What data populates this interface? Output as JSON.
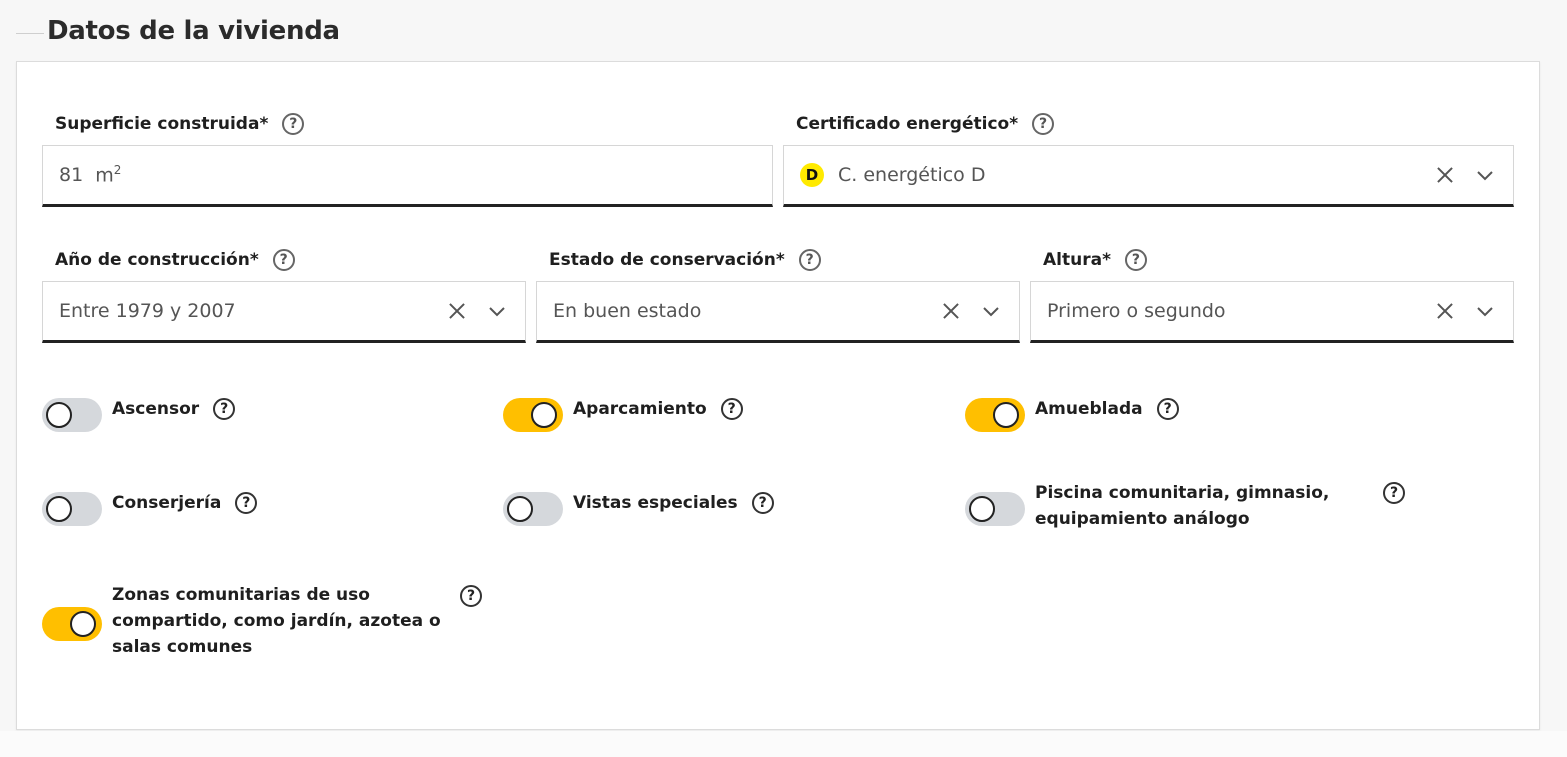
{
  "section": {
    "title": "Datos de la vivienda"
  },
  "fields": {
    "superficie": {
      "label": "Superficie construida*",
      "value": "81",
      "unit": "m",
      "unit_sup": "2"
    },
    "certificado": {
      "label": "Certificado energético*",
      "badge": "D",
      "value": "C. energético D"
    },
    "anio": {
      "label": "Año de construcción*",
      "value": "Entre 1979 y 2007"
    },
    "estado": {
      "label": "Estado de conservación*",
      "value": "En buen estado"
    },
    "altura": {
      "label": "Altura*",
      "value": "Primero o segundo"
    }
  },
  "toggles": {
    "ascensor": {
      "label": "Ascensor",
      "on": false
    },
    "aparcamiento": {
      "label": "Aparcamiento",
      "on": true
    },
    "amueblada": {
      "label": "Amueblada",
      "on": true
    },
    "conserjeria": {
      "label": "Conserjería",
      "on": false
    },
    "vistas": {
      "label": "Vistas especiales",
      "on": false
    },
    "piscina": {
      "label_line1": "Piscina comunitaria, gimnasio,",
      "label_line2": "equipamiento análogo",
      "on": false
    },
    "zonas": {
      "label_line1": "Zonas comunitarias de uso",
      "label_line2": "compartido, como jardín, azotea o",
      "label_line3": "salas comunes",
      "on": true
    }
  },
  "help_glyph": "?",
  "colors": {
    "toggle_on": "#ffbf00",
    "toggle_off": "#d5d8dc",
    "energy_d": "#ffea00"
  },
  "icons": {
    "clear": "close-icon",
    "dropdown": "chevron-down-icon",
    "help": "question-circle-icon"
  }
}
